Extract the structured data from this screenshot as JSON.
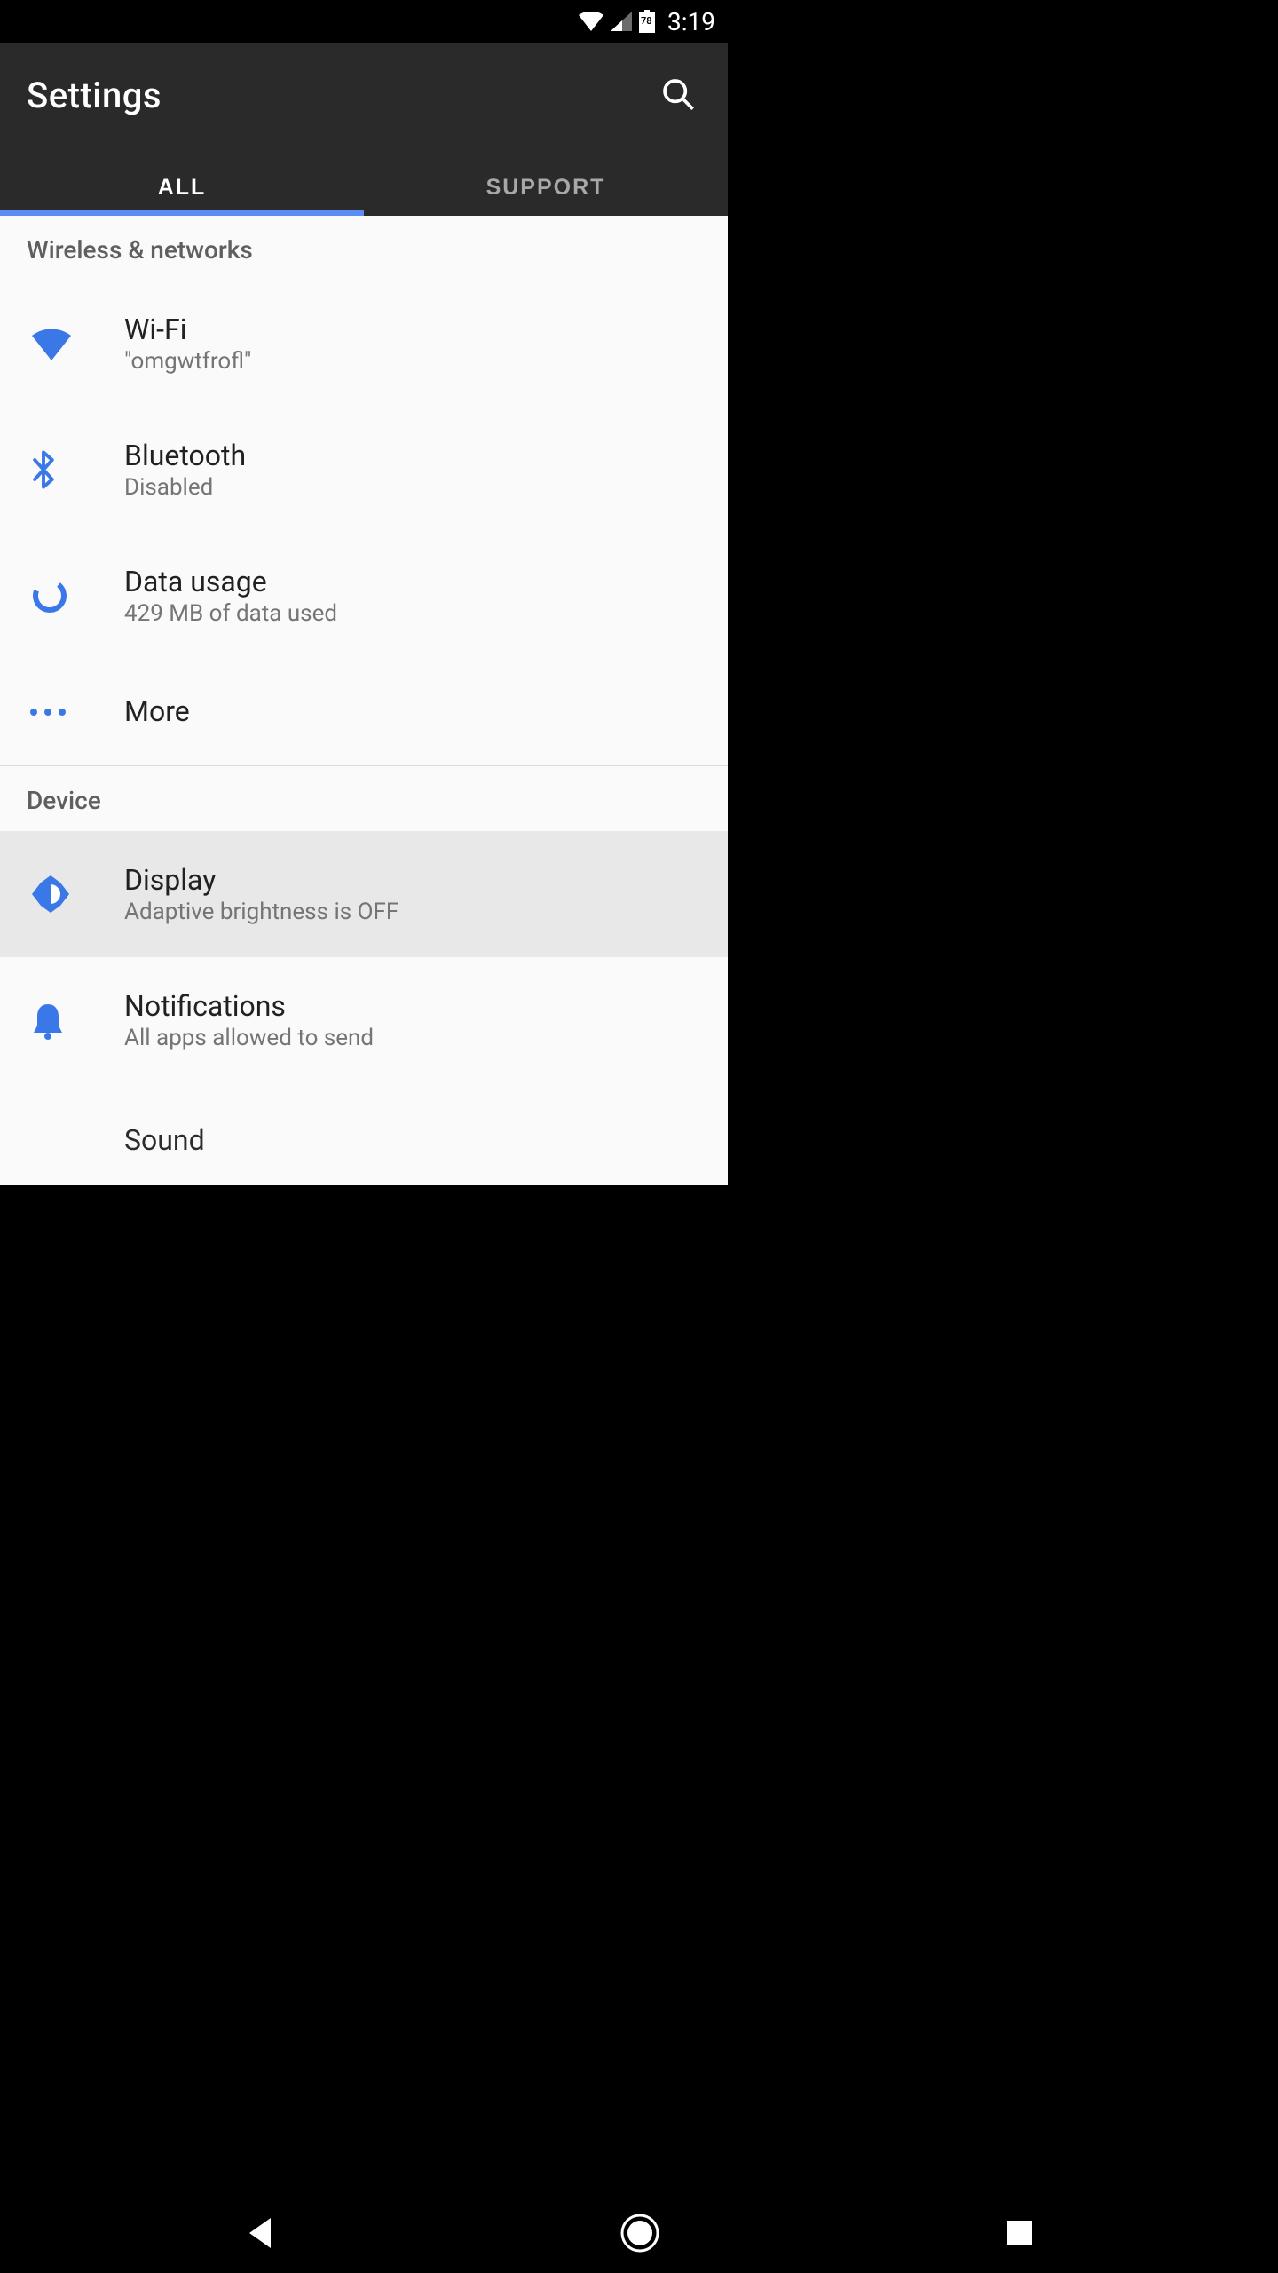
{
  "status": {
    "battery_pct": "78",
    "time": "3:19"
  },
  "header": {
    "title": "Settings"
  },
  "tabs": {
    "all": "ALL",
    "support": "SUPPORT"
  },
  "sections": {
    "wireless": {
      "label": "Wireless & networks",
      "wifi": {
        "title": "Wi-Fi",
        "subtitle": "\"omgwtfrofl\""
      },
      "bluetooth": {
        "title": "Bluetooth",
        "subtitle": "Disabled"
      },
      "data": {
        "title": "Data usage",
        "subtitle": "429 MB of data used"
      },
      "more": {
        "title": "More"
      }
    },
    "device": {
      "label": "Device",
      "display": {
        "title": "Display",
        "subtitle": "Adaptive brightness is OFF"
      },
      "notifications": {
        "title": "Notifications",
        "subtitle": "All apps allowed to send"
      },
      "sound": {
        "title": "Sound"
      }
    }
  },
  "colors": {
    "accent": "#3b78e7"
  }
}
